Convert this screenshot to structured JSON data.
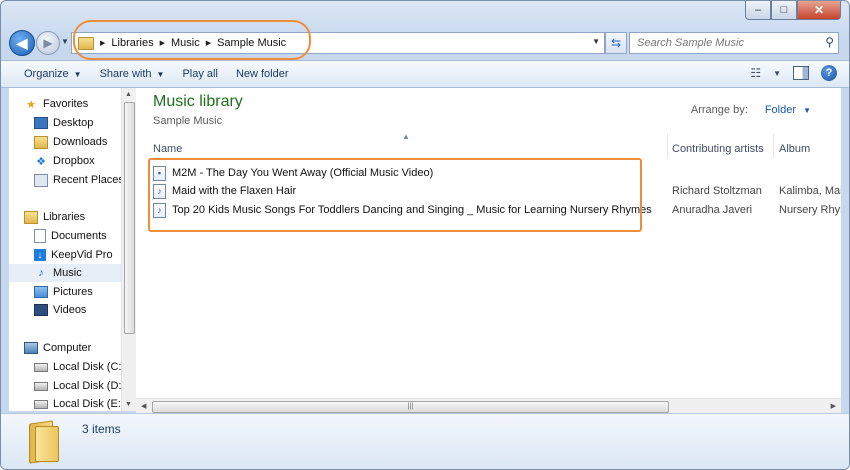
{
  "window": {
    "caption": {
      "minimize": "–",
      "maximize": "□",
      "close": "✕"
    }
  },
  "nav": {
    "back": "◀",
    "forward": "▶",
    "breadcrumb": [
      "Libraries",
      "Music",
      "Sample Music"
    ],
    "search_placeholder": "Search Sample Music"
  },
  "toolbar": {
    "organize": "Organize",
    "share_with": "Share with",
    "play_all": "Play all",
    "new_folder": "New folder",
    "help": "?"
  },
  "navpane": {
    "favorites": {
      "header": "Favorites",
      "items": [
        "Desktop",
        "Downloads",
        "Dropbox",
        "Recent Places"
      ]
    },
    "libraries": {
      "header": "Libraries",
      "items": [
        "Documents",
        "KeepVid Pro",
        "Music",
        "Pictures",
        "Videos"
      ],
      "selected": "Music"
    },
    "computer": {
      "header": "Computer",
      "items": [
        "Local Disk (C:)",
        "Local Disk (D:)",
        "Local Disk (E:)"
      ]
    }
  },
  "content": {
    "title": "Music library",
    "subtitle": "Sample Music",
    "arrange_label": "Arrange by:",
    "arrange_value": "Folder",
    "columns": {
      "name": "Name",
      "artists": "Contributing artists",
      "album": "Album"
    },
    "rows": [
      {
        "name": "M2M - The Day You Went Away (Official Music Video)",
        "artists": "",
        "album": ""
      },
      {
        "name": "Maid with the Flaxen Hair",
        "artists": "Richard Stoltzman",
        "album": "Kalimba, Maid"
      },
      {
        "name": "Top 20 Kids Music Songs For Toddlers Dancing and Singing _ Music for Learning Nursery Rhymes",
        "artists": "Anuradha Javeri",
        "album": "Nursery Rhym"
      }
    ]
  },
  "details": {
    "count": "3 items"
  },
  "colors": {
    "library_title": "#1e6f1e",
    "accent_link": "#1a5ab0",
    "highlight": "#f08c3a"
  }
}
